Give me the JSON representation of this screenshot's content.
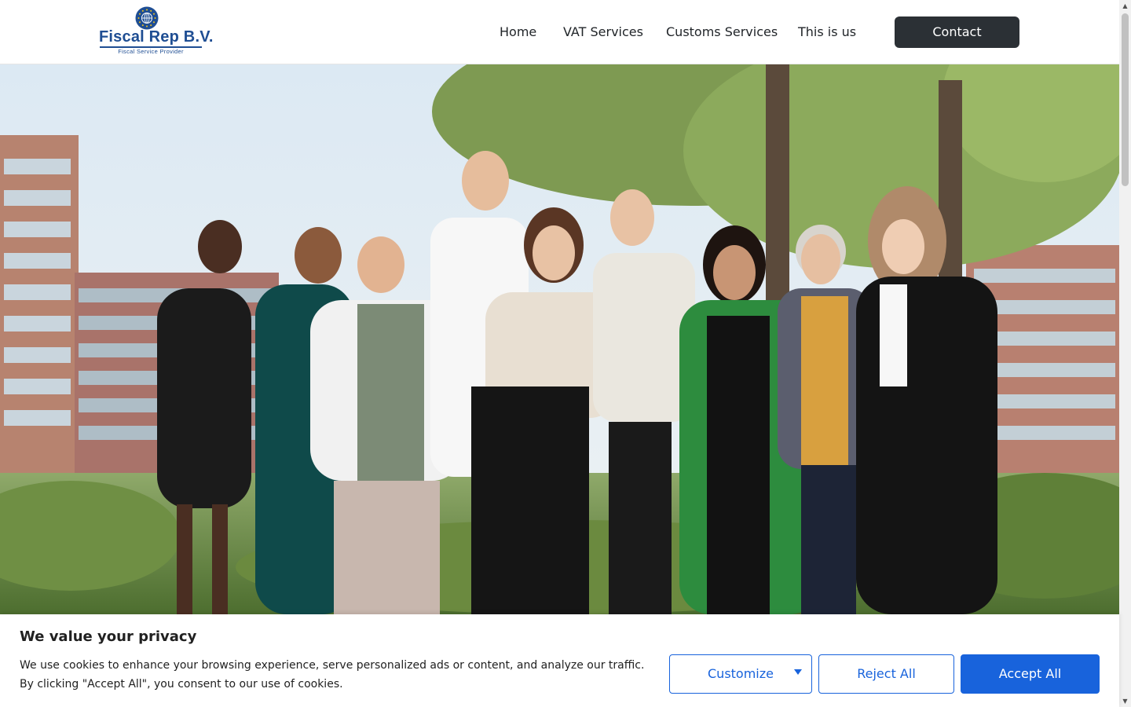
{
  "header": {
    "logo": {
      "name": "Fiscal Rep B.V.",
      "tagline": "Fiscal Service Provider",
      "icon": "globe-icon"
    },
    "nav": [
      {
        "label": "Home"
      },
      {
        "label": "VAT Services"
      },
      {
        "label": "Customs Services"
      },
      {
        "label": "This is us"
      }
    ],
    "contact_label": "Contact"
  },
  "hero": {
    "content": "team-photo"
  },
  "cookie_banner": {
    "title": "We value your privacy",
    "text_line1": "We use cookies to enhance your browsing experience, serve personalized ads or content, and analyze our traffic.",
    "text_line2": "By clicking \"Accept All\", you consent to our use of cookies.",
    "customize_label": "Customize",
    "reject_label": "Reject All",
    "accept_label": "Accept All"
  },
  "colors": {
    "brand_blue": "#1f4e93",
    "contact_bg": "#2b3035",
    "cookie_accent": "#1863dc"
  }
}
